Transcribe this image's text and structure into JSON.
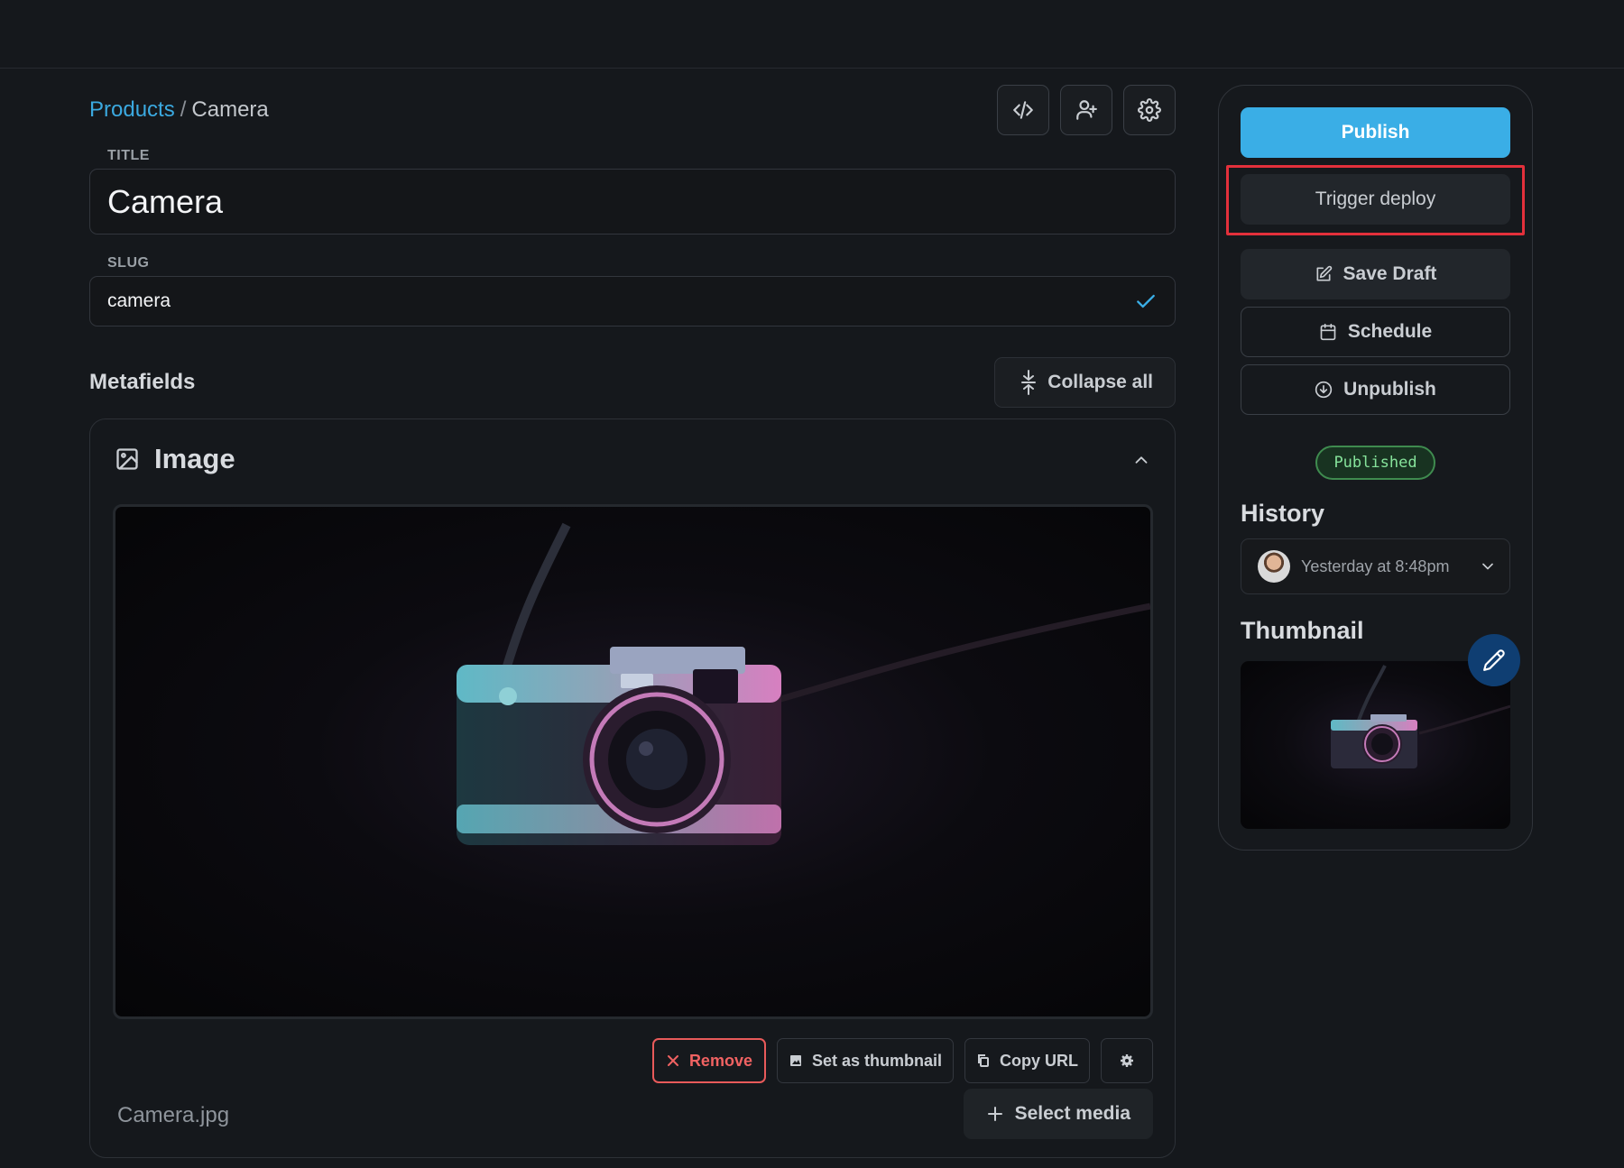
{
  "breadcrumb": {
    "parent": "Products",
    "separator": "/",
    "current": "Camera"
  },
  "toolbar": {
    "icons": [
      "code-icon",
      "user-plus-icon",
      "gear-icon"
    ]
  },
  "fields": {
    "title_label": "TITLE",
    "title_value": "Camera",
    "slug_label": "SLUG",
    "slug_value": "camera"
  },
  "metafields": {
    "heading": "Metafields",
    "collapse_label": "Collapse all"
  },
  "image_card": {
    "title": "Image",
    "actions": {
      "remove": "Remove",
      "set_thumbnail": "Set as thumbnail",
      "copy_url": "Copy URL"
    },
    "filename": "Camera.jpg",
    "select_media": "Select media"
  },
  "sidebar": {
    "publish": "Publish",
    "trigger_deploy": "Trigger deploy",
    "save_draft": "Save Draft",
    "schedule": "Schedule",
    "unpublish": "Unpublish",
    "status": "Published",
    "history_title": "History",
    "history_value": "Yesterday at 8:48pm",
    "thumbnail_title": "Thumbnail"
  },
  "colors": {
    "accent": "#3aaee6",
    "link": "#3ba9e0",
    "danger": "#f06262",
    "success": "#86e39b",
    "highlight": "#e3303b"
  }
}
